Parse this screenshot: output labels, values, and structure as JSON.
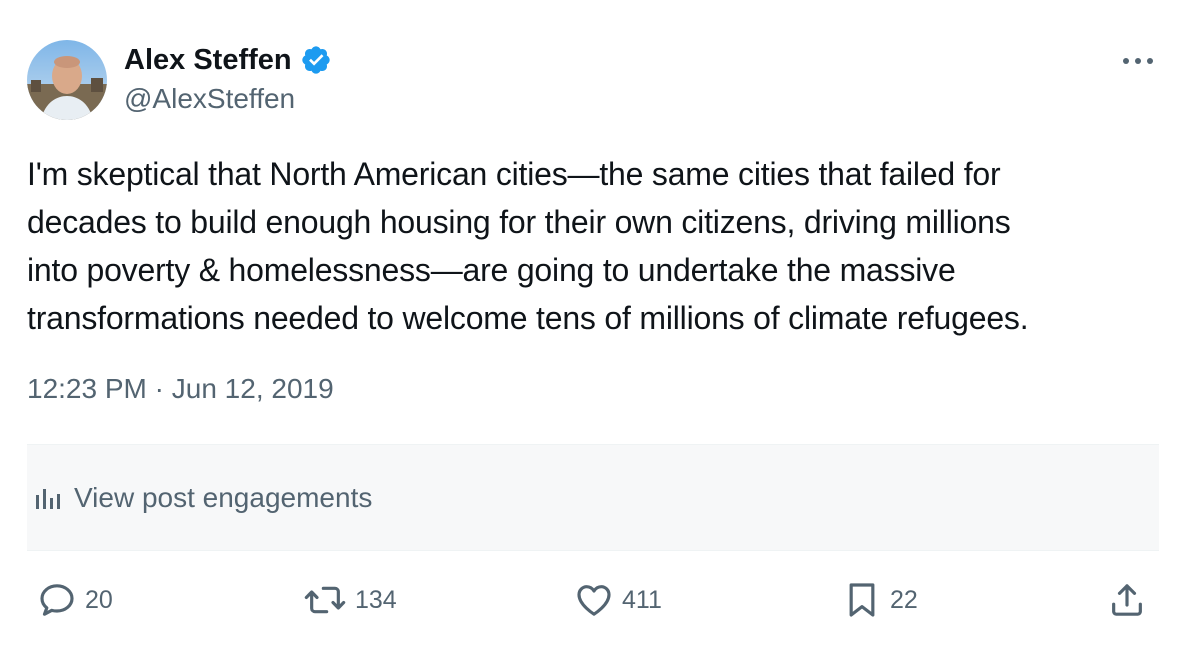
{
  "author": {
    "name": "Alex Steffen",
    "handle": "@AlexSteffen",
    "verified": true
  },
  "tweet": {
    "text": "I'm skeptical that North American cities—the same cities that failed for\ndecades to build enough housing for their own citizens, driving millions\ninto poverty & homelessness—are going to undertake the massive\ntransformations needed to welcome tens of millions of climate refugees.",
    "time": "12:23 PM",
    "separator": " · ",
    "date": "Jun 12, 2019"
  },
  "engagements": {
    "label": "View post engagements",
    "icon": "bar-chart-icon"
  },
  "actions": {
    "reply": {
      "count": "20",
      "icon": "reply-icon"
    },
    "repost": {
      "count": "134",
      "icon": "repost-icon"
    },
    "like": {
      "count": "411",
      "icon": "heart-icon"
    },
    "bookmark": {
      "count": "22",
      "icon": "bookmark-icon"
    },
    "share": {
      "icon": "share-icon"
    }
  },
  "colors": {
    "text": "#0f1419",
    "secondary": "#536471",
    "verified": "#1d9bf0",
    "engagement_bg": "#f7f8f9"
  }
}
